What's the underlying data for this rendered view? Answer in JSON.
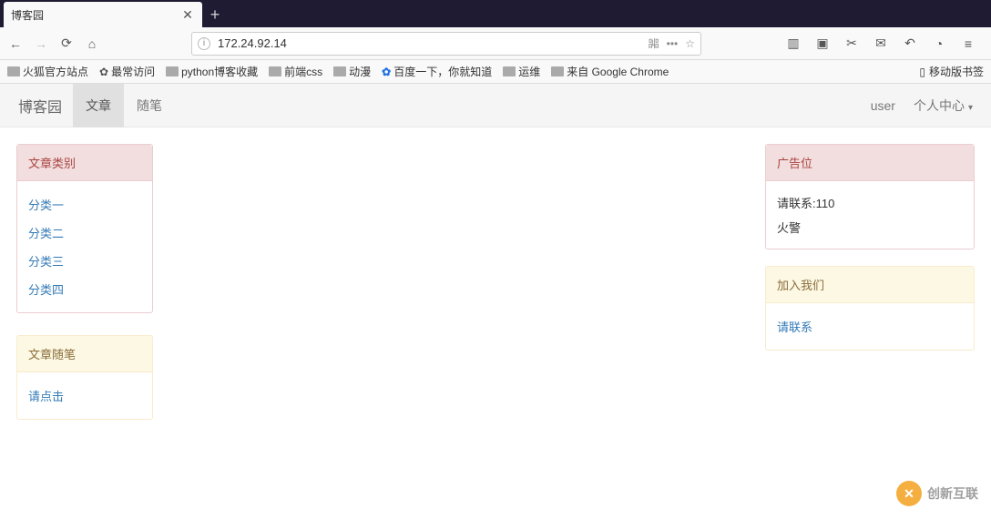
{
  "browser": {
    "tab_title": "博客园",
    "url": "172.24.92.14",
    "bookmarks": [
      "火狐官方站点",
      "最常访问",
      "python博客收藏",
      "前端css",
      "动漫",
      "百度一下，你就知道",
      "运维",
      "来自 Google Chrome"
    ],
    "mobile_bm": "移动版书签",
    "qr_label": "嘂",
    "dots_label": "•••",
    "star_label": "☆"
  },
  "page": {
    "brand": "博客园",
    "nav": {
      "articles": "文章",
      "essays": "随笔"
    },
    "user": "user",
    "user_center": "个人中心"
  },
  "sidebar": {
    "categories_title": "文章类别",
    "categories": [
      "分类一",
      "分类二",
      "分类三",
      "分类四"
    ],
    "essays_title": "文章随笔",
    "essay_link": "请点击"
  },
  "rightbar": {
    "ad_title": "广告位",
    "ad_lines": [
      "请联系:110",
      "火警"
    ],
    "join_title": "加入我们",
    "join_link": "请联系"
  },
  "watermark": "创新互联"
}
